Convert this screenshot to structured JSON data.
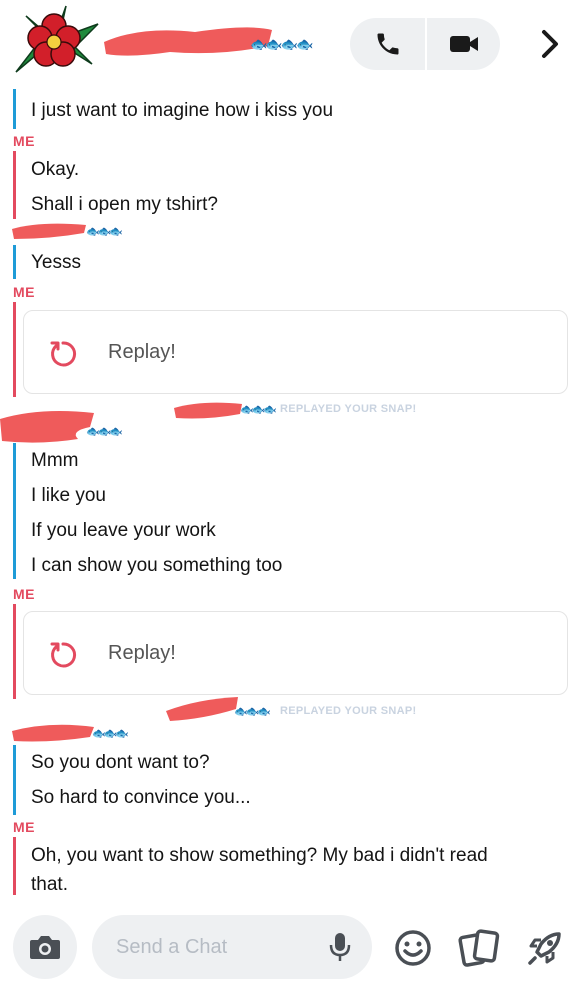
{
  "header": {
    "call_icon": "phone-icon",
    "video_icon": "video-camera-icon",
    "chevron_icon": "chevron-right-icon"
  },
  "messages": {
    "m1": "I just want to imagine how i kiss you",
    "me1": "ME",
    "m2": "Okay.",
    "m3": "Shall i open my tshirt?",
    "m4": "Yesss",
    "me2": "ME",
    "replay1": "Replay!",
    "note1": "REPLAYED YOUR SNAP!",
    "m5": "Mmm",
    "m6": "I like you",
    "m7": "If you leave your work",
    "m8": "I can show you something too",
    "me3": "ME",
    "replay2": "Replay!",
    "note2": "REPLAYED YOUR SNAP!",
    "m9": "So you dont want to?",
    "m10": "So hard to convince you...",
    "me4": "ME",
    "m11a": "Oh, you want to show something? My bad i didn't read",
    "m11b": "that."
  },
  "composer": {
    "placeholder": "Send a Chat"
  },
  "colors": {
    "friend_bar": "#1e9bd7",
    "me_bar": "#e34a5f",
    "redaction": "#ef5b5b"
  }
}
